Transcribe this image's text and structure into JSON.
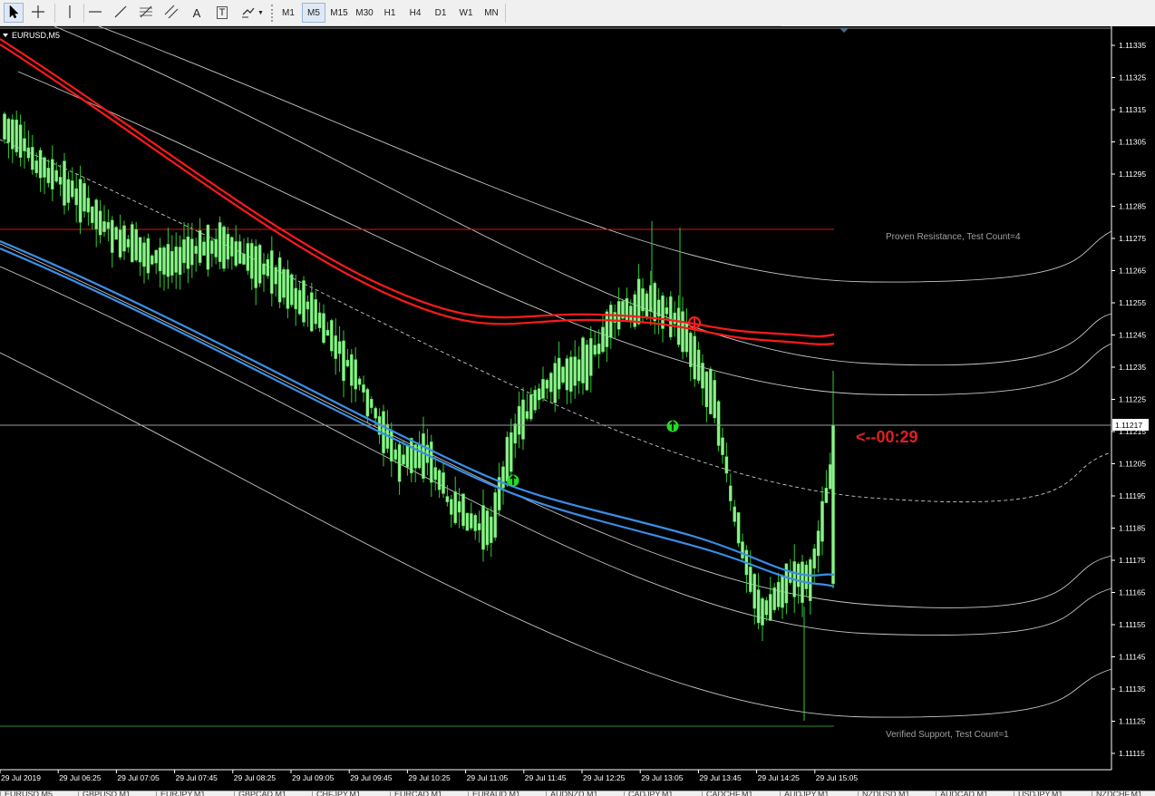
{
  "toolbar": {
    "tools": [
      {
        "name": "cursor-tool-button",
        "icon": "cursor-icon"
      },
      {
        "name": "crosshair-tool-button",
        "icon": "crosshair-icon"
      },
      {
        "name": "vertical-line-tool-button",
        "icon": "vertical-line-icon"
      },
      {
        "name": "horizontal-line-tool-button",
        "icon": "horizontal-line-icon"
      },
      {
        "name": "trendline-tool-button",
        "icon": "trendline-icon"
      },
      {
        "name": "fibonacci-tool-button",
        "icon": "fibonacci-icon"
      },
      {
        "name": "equidistant-channel-tool-button",
        "icon": "channel-icon"
      },
      {
        "name": "text-tool-button",
        "icon": "text-icon",
        "label": "A"
      },
      {
        "name": "text-label-tool-button",
        "icon": "text-label-icon",
        "label": "T"
      },
      {
        "name": "shapes-tool-button",
        "icon": "shapes-icon"
      }
    ],
    "timeframes": [
      "M1",
      "M5",
      "M15",
      "M30",
      "H1",
      "H4",
      "D1",
      "W1",
      "MN"
    ],
    "active_timeframe": "M5"
  },
  "chart": {
    "symbol_label": "EURUSD,M5",
    "price_axis_labels": [
      "1.11335",
      "1.11325",
      "1.11315",
      "1.11305",
      "1.11295",
      "1.11285",
      "1.11275",
      "1.11265",
      "1.11255",
      "1.11245",
      "1.11235",
      "1.11225",
      "1.11215",
      "1.11205",
      "1.11195",
      "1.11185",
      "1.11175",
      "1.11165",
      "1.11155",
      "1.11145",
      "1.11135",
      "1.11125",
      "1.11115"
    ],
    "current_price": "1.11217",
    "countdown": "<--00:29",
    "resistance_label": "Proven Resistance, Test Count=4",
    "support_label": "Verified Support, Test Count=1",
    "time_axis_labels": [
      "29 Jul 2019",
      "29 Jul 06:25",
      "29 Jul 07:05",
      "29 Jul 07:45",
      "29 Jul 08:25",
      "29 Jul 09:05",
      "29 Jul 09:45",
      "29 Jul 10:25",
      "29 Jul 11:05",
      "29 Jul 11:45",
      "29 Jul 12:25",
      "29 Jul 13:05",
      "29 Jul 13:45",
      "29 Jul 14:25",
      "29 Jul 15:05"
    ],
    "colors": {
      "background": "#000000",
      "candle": "#90ee90",
      "wick": "#32cd32",
      "red_ma": "#ff1a1a",
      "blue_ma": "#3a8ee6",
      "channel": "#c8c8c8",
      "resistance": "#e01010",
      "support": "#2e8b2e",
      "countdown": "#e02020",
      "zone_text": "#a0a0a0",
      "axis_text": "#ffffff",
      "signal": "#22dd22"
    }
  },
  "bottom_tabs": [
    "EURUSD,M5",
    "GBPUSD,M1",
    "EURJPY,M1",
    "GBPCAD,M1",
    "CHFJPY,M1",
    "EURCAD,M1",
    "EURAUD,M1",
    "AUDNZD,M1",
    "CADJPY,M1",
    "CADCHF,M1",
    "AUDJPY,M1",
    "NZDUSD,M1",
    "AUDCAD,M1",
    "USDJPY,M1",
    "NZDCHF,M1"
  ]
}
